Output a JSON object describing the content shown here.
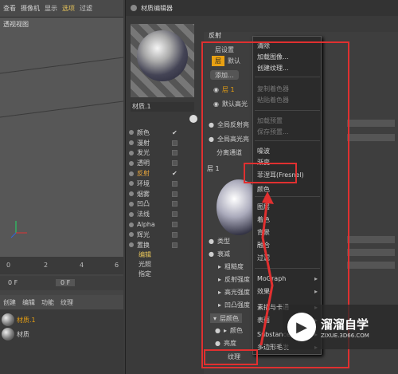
{
  "left_panel": {
    "menu": [
      "查看",
      "摄像机",
      "显示",
      "选项",
      "过滤"
    ],
    "active_menu": "选项",
    "viewport_title": "透视视图",
    "timeline_ticks": [
      "0",
      "2",
      "4",
      "6"
    ],
    "frame_value": "0 F",
    "frame_value2": "0 F",
    "obj_menu": [
      "创建",
      "编辑",
      "功能",
      "纹理"
    ],
    "materials": [
      "材质.1",
      "材质"
    ]
  },
  "editor": {
    "title": "材质编辑器",
    "material_name": "材质.1",
    "channels": [
      {
        "name": "颜色",
        "checked": true
      },
      {
        "name": "漫射",
        "checked": false
      },
      {
        "name": "发光",
        "checked": false
      },
      {
        "name": "透明",
        "checked": false
      },
      {
        "name": "反射",
        "checked": true,
        "active": true
      },
      {
        "name": "环境",
        "checked": false
      },
      {
        "name": "烟雾",
        "checked": false
      },
      {
        "name": "凹凸",
        "checked": false
      },
      {
        "name": "法线",
        "checked": false
      },
      {
        "name": "Alpha",
        "checked": false
      },
      {
        "name": "辉光",
        "checked": false
      },
      {
        "name": "置换",
        "checked": false
      }
    ],
    "extra_items": [
      "编辑",
      "光照",
      "指定"
    ],
    "props": {
      "header": "反射",
      "layer_settings": "层设置",
      "layer_tab": "层",
      "default_tab": "默认",
      "add_button": "添加...",
      "layer1": "层 1",
      "default_highlight": "默认高光",
      "global_refl": "全局反射亮",
      "global_spec": "全局高光亮",
      "split": "分离通道",
      "layer_header": "层 1",
      "rows": [
        "类型",
        "衰减",
        "粗糙度",
        "反射强度",
        "高光强度",
        "凹凸强度"
      ],
      "layer_color": "层颜色",
      "color": "颜色",
      "brightness": "亮度",
      "texture": "纹理"
    }
  },
  "context_menu": {
    "items": [
      {
        "label": "清除",
        "disabled": false
      },
      {
        "label": "加载图像...",
        "disabled": false
      },
      {
        "label": "创建纹理...",
        "disabled": false
      },
      {
        "label": "复制着色器",
        "disabled": true
      },
      {
        "label": "粘贴着色器",
        "disabled": true
      },
      {
        "label": "加载预置",
        "disabled": true
      },
      {
        "label": "保存预置...",
        "disabled": true
      },
      {
        "label": "噪波",
        "disabled": false
      },
      {
        "label": "渐变",
        "disabled": false
      },
      {
        "label": "菲涅耳(Fresnel)",
        "disabled": false
      },
      {
        "label": "颜色",
        "disabled": false
      },
      {
        "label": "图层",
        "disabled": false
      },
      {
        "label": "着色",
        "disabled": false
      },
      {
        "label": "背景",
        "disabled": false
      },
      {
        "label": "融合",
        "disabled": false
      },
      {
        "label": "过滤",
        "disabled": false
      },
      {
        "label": "MoGraph",
        "disabled": false,
        "submenu": true
      },
      {
        "label": "效果",
        "disabled": false,
        "submenu": true
      },
      {
        "label": "素描与卡通",
        "disabled": false,
        "submenu": true
      },
      {
        "label": "表面",
        "disabled": false,
        "submenu": true
      },
      {
        "label": "Substance",
        "disabled": false,
        "submenu": true
      },
      {
        "label": "多边形毛发",
        "disabled": false,
        "submenu": true
      }
    ]
  },
  "watermark": {
    "title": "溜溜自学",
    "url": "ZIXUE.3D66.COM"
  },
  "colors": {
    "accent": "#e8a012",
    "red": "#e03030"
  }
}
